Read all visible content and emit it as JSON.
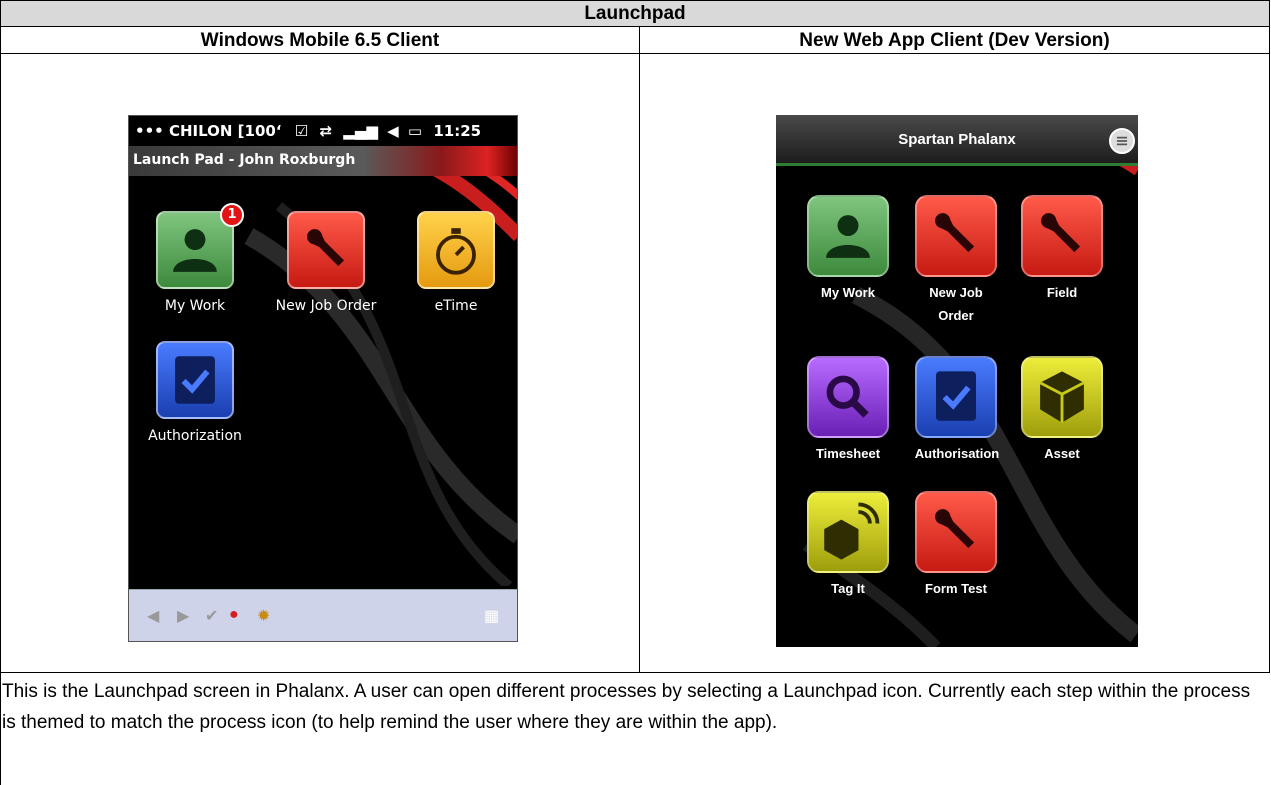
{
  "document": {
    "title": "Launchpad",
    "left_header": "Windows Mobile 6.5 Client",
    "right_header": "New Web App Client (Dev Version)",
    "caption": "This is the Launchpad screen in Phalanx. A user can open different processes by selecting a Launchpad icon. Currently each step within the process is themed to match the process icon (to help remind the user where they are within the app)."
  },
  "wm_client": {
    "status_bar": "••• CHILON [100‘",
    "clock": "11:25",
    "window_title": "Launch Pad - John Roxburgh",
    "tiles": [
      {
        "label": "My Work",
        "icon": "person-icon",
        "color": "#5aa55a",
        "badge": "1"
      },
      {
        "label": "New Job Order",
        "icon": "wrench-icon",
        "color": "#e8302a"
      },
      {
        "label": "eTime",
        "icon": "stopwatch-icon",
        "color": "#f5b921"
      },
      {
        "label": "Authorization",
        "icon": "clipboard-check-icon",
        "color": "#2456d6"
      }
    ]
  },
  "web_client": {
    "app_title": "Spartan Phalanx",
    "tiles": [
      {
        "label": "My Work",
        "icon": "person-icon",
        "color": "#5aa55a"
      },
      {
        "label": "New Job Order",
        "icon": "wrench-icon",
        "color": "#e8302a"
      },
      {
        "label": "Field",
        "icon": "wrench-icon",
        "color": "#e8302a"
      },
      {
        "label": "Timesheet",
        "icon": "magnifier-icon",
        "color": "#8e3fd6"
      },
      {
        "label": "Authorisation",
        "icon": "clipboard-check-icon",
        "color": "#2456d6"
      },
      {
        "label": "Asset",
        "icon": "cube-icon",
        "color": "#c9c91a"
      },
      {
        "label": "Tag It",
        "icon": "cube-signal-icon",
        "color": "#c9c91a"
      },
      {
        "label": "Form Test",
        "icon": "wrench-icon",
        "color": "#e8302a"
      }
    ]
  },
  "colors": {
    "header_gray": "#d9d9d9",
    "wm_bar": "#cfd3ea",
    "web_header_accent": "#2e7d32"
  }
}
